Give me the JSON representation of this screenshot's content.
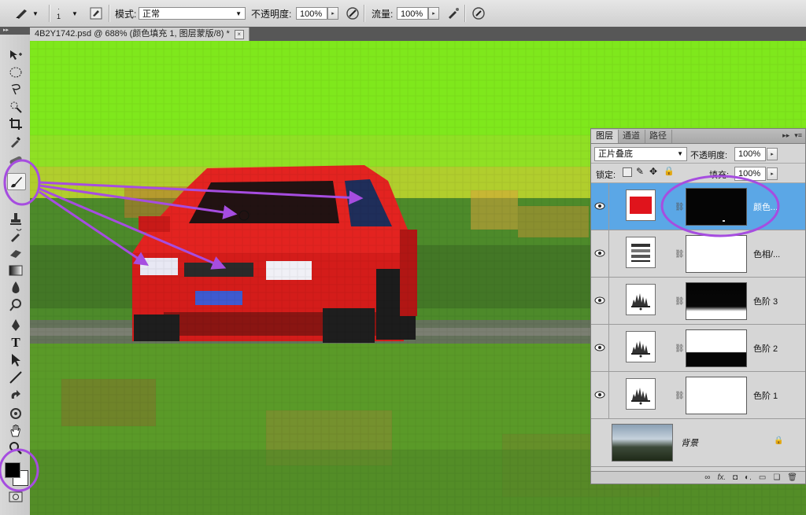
{
  "options_bar": {
    "brush_size": "1",
    "mode_label": "模式:",
    "mode_value": "正常",
    "opacity_label": "不透明度:",
    "opacity_value": "100%",
    "flow_label": "流量:",
    "flow_value": "100%"
  },
  "document_tab": {
    "title": "4B2Y1742.psd @ 688% (颜色填充 1, 图层蒙版/8) *",
    "close": "×"
  },
  "layers_panel": {
    "tabs": [
      "图层",
      "通道",
      "路径"
    ],
    "blend_mode": "正片叠底",
    "opacity_label": "不透明度:",
    "opacity_value": "100%",
    "lock_label": "锁定:",
    "fill_label": "填充:",
    "fill_value": "100%",
    "layers": [
      {
        "name": "颜色...",
        "type": "color-fill",
        "selected": true
      },
      {
        "name": "色相/...",
        "type": "hue-saturation",
        "selected": false
      },
      {
        "name": "色阶 3",
        "type": "levels",
        "selected": false
      },
      {
        "name": "色阶 2",
        "type": "levels",
        "selected": false
      },
      {
        "name": "色阶 1",
        "type": "levels",
        "selected": false
      },
      {
        "name": "背景",
        "type": "background",
        "selected": false
      }
    ]
  },
  "colors": {
    "foreground": "#000000",
    "background": "#ffffff",
    "fill_layer_color": "#e0141c",
    "selection_blue": "#5ba7e6",
    "annotation_purple": "#a64de0",
    "car_red": "#e4201f"
  }
}
